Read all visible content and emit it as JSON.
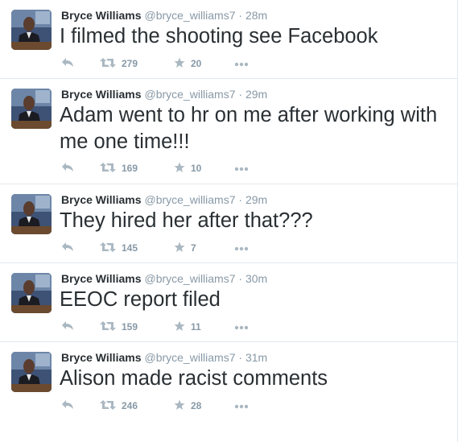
{
  "tweets": [
    {
      "fullname": "Bryce Williams",
      "handle": "@bryce_williams7",
      "dot": "·",
      "time": "28m",
      "text": "I filmed the shooting see Facebook",
      "retweets": "279",
      "favorites": "20"
    },
    {
      "fullname": "Bryce Williams",
      "handle": "@bryce_williams7",
      "dot": "·",
      "time": "29m",
      "text": "Adam went to hr on me after working with me one time!!!",
      "retweets": "169",
      "favorites": "10"
    },
    {
      "fullname": "Bryce Williams",
      "handle": "@bryce_williams7",
      "dot": "·",
      "time": "29m",
      "text": "They hired her after that???",
      "retweets": "145",
      "favorites": "7"
    },
    {
      "fullname": "Bryce Williams",
      "handle": "@bryce_williams7",
      "dot": "·",
      "time": "30m",
      "text": "EEOC report filed",
      "retweets": "159",
      "favorites": "11"
    },
    {
      "fullname": "Bryce Williams",
      "handle": "@bryce_williams7",
      "dot": "·",
      "time": "31m",
      "text": "Alison made racist comments",
      "retweets": "246",
      "favorites": "28"
    }
  ],
  "icons": {
    "reply": "reply-icon",
    "retweet": "retweet-icon",
    "favorite": "star-icon",
    "more": "more-dots-icon"
  },
  "colors": {
    "text": "#292f33",
    "muted": "#8899a6",
    "icon": "#aab8c2",
    "divider": "#e1e8ed"
  }
}
